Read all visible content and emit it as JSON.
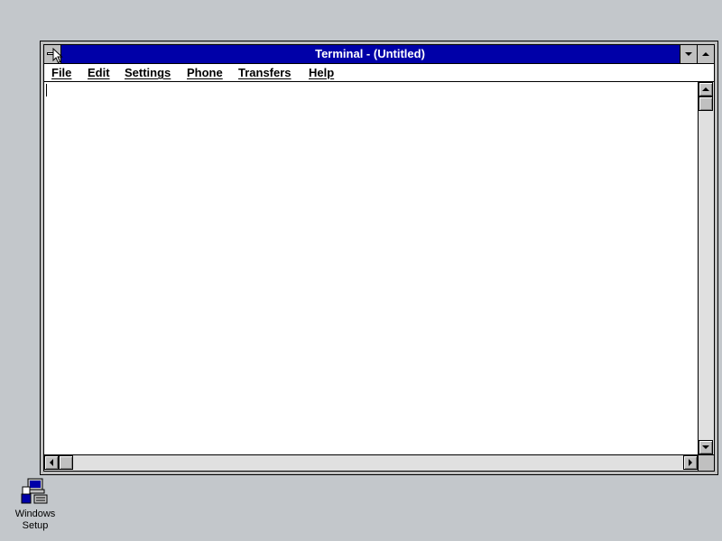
{
  "window": {
    "title": "Terminal - (Untitled)"
  },
  "menubar": {
    "items": [
      {
        "label": "File"
      },
      {
        "label": "Edit"
      },
      {
        "label": "Settings"
      },
      {
        "label": "Phone"
      },
      {
        "label": "Transfers"
      },
      {
        "label": "Help"
      }
    ]
  },
  "desktop": {
    "icons": [
      {
        "label_line1": "Windows",
        "label_line2": "Setup",
        "icon": "windows-setup-icon"
      }
    ]
  },
  "colors": {
    "desktop": "#c3c7cb",
    "titlebar_active": "#0000a8",
    "client": "#ffffff"
  }
}
